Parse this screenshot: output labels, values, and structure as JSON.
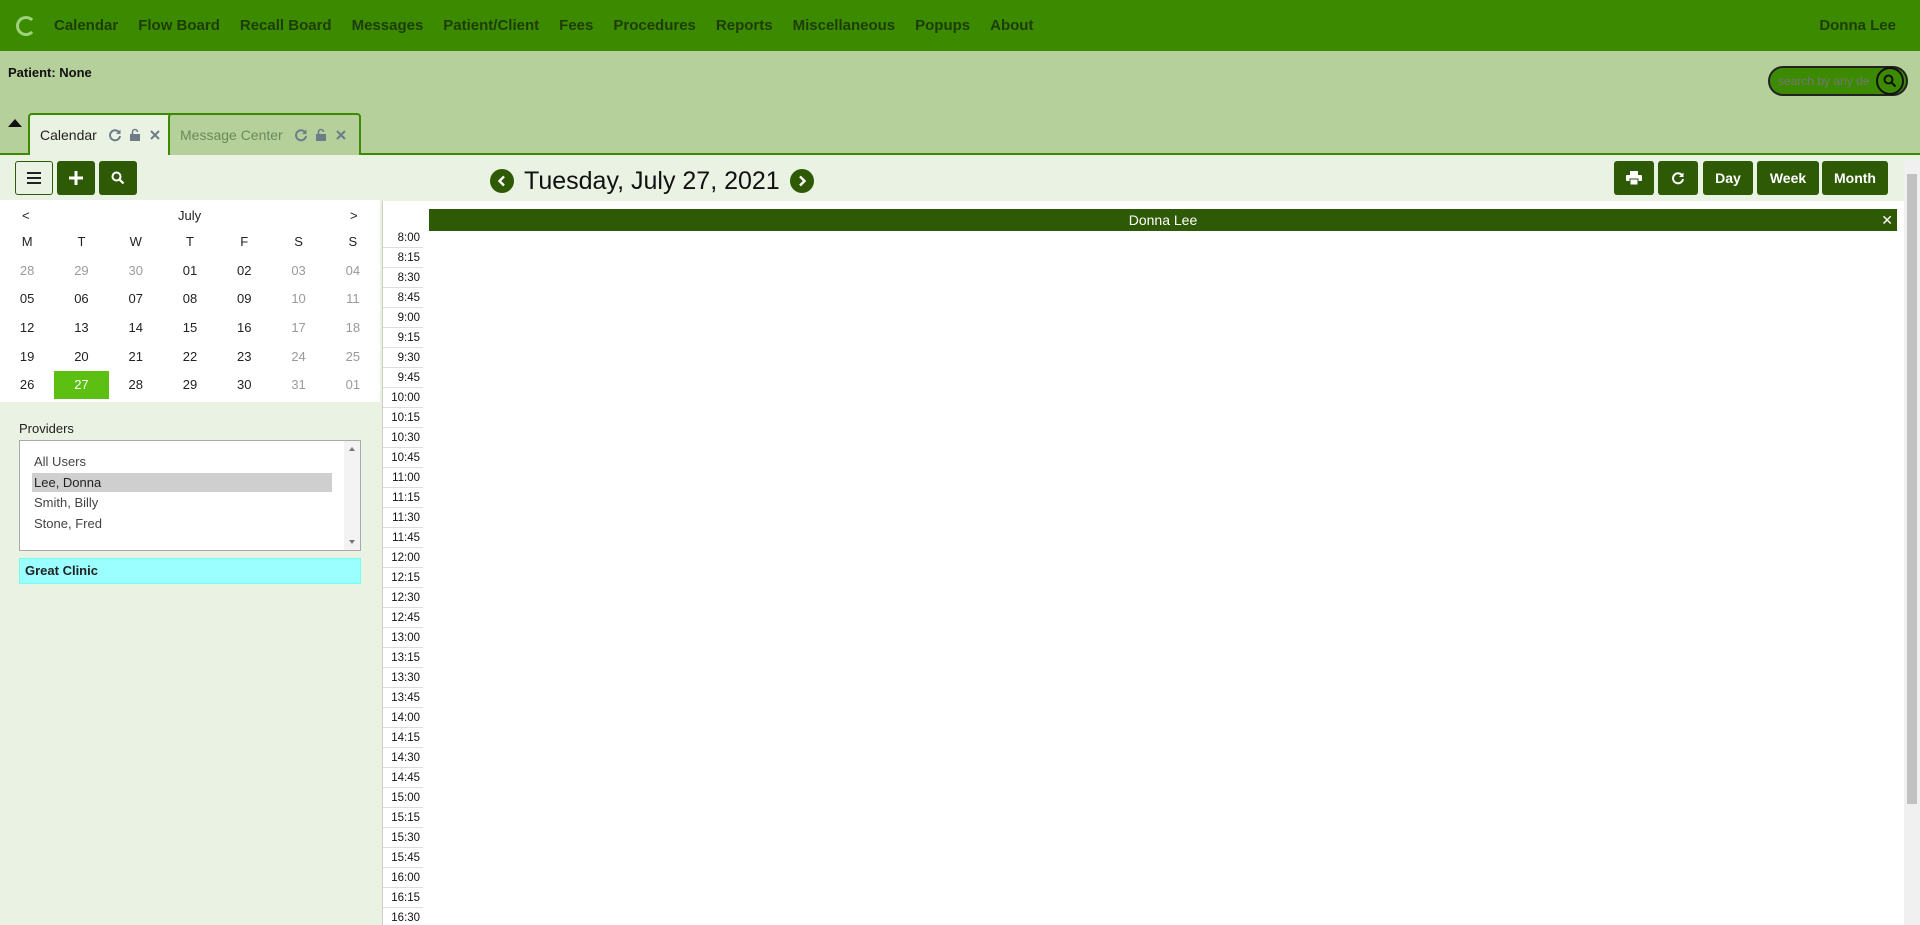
{
  "nav": {
    "items": [
      "Calendar",
      "Flow Board",
      "Recall Board",
      "Messages",
      "Patient/Client",
      "Fees",
      "Procedures",
      "Reports",
      "Miscellaneous",
      "Popups",
      "About"
    ],
    "user": "Donna Lee"
  },
  "patient_bar": {
    "patient_label": "Patient: None",
    "search_placeholder": "search by any de"
  },
  "tabs": [
    {
      "label": "Calendar",
      "active": true
    },
    {
      "label": "Message Center",
      "active": false
    }
  ],
  "toolbar": {
    "date": "Tuesday, July 27, 2021",
    "views": [
      "Day",
      "Week",
      "Month"
    ]
  },
  "mini_calendar": {
    "month": "July",
    "prev": "<",
    "next": ">",
    "weekdays": [
      "M",
      "T",
      "W",
      "T",
      "F",
      "S",
      "S"
    ],
    "weeks": [
      [
        "28",
        "29",
        "30",
        "01",
        "02",
        "03",
        "04"
      ],
      [
        "05",
        "06",
        "07",
        "08",
        "09",
        "10",
        "11"
      ],
      [
        "12",
        "13",
        "14",
        "15",
        "16",
        "17",
        "18"
      ],
      [
        "19",
        "20",
        "21",
        "22",
        "23",
        "24",
        "25"
      ],
      [
        "26",
        "27",
        "28",
        "29",
        "30",
        "31",
        "01"
      ]
    ],
    "selected": "27"
  },
  "providers": {
    "label": "Providers",
    "items": [
      "All Users",
      "Lee, Donna",
      "Smith, Billy",
      "Stone, Fred"
    ],
    "selected": "Lee, Donna"
  },
  "facility": "Great Clinic",
  "schedule": {
    "provider": "Donna Lee",
    "times": [
      "8:00",
      "8:15",
      "8:30",
      "8:45",
      "9:00",
      "9:15",
      "9:30",
      "9:45",
      "10:00",
      "10:15",
      "10:30",
      "10:45",
      "11:00",
      "11:15",
      "11:30",
      "11:45",
      "12:00",
      "12:15",
      "12:30",
      "12:45",
      "13:00",
      "13:15",
      "13:30",
      "13:45",
      "14:00",
      "14:15",
      "14:30",
      "14:45",
      "15:00",
      "15:15",
      "15:30",
      "15:45",
      "16:00",
      "16:15",
      "16:30"
    ]
  },
  "colors": {
    "nav_bg": "#3c8a00",
    "patient_bar_bg": "#b5d09a",
    "dark_green": "#2e5a06",
    "selected_day": "#5cbf12",
    "facility_bg": "#9bffff"
  }
}
